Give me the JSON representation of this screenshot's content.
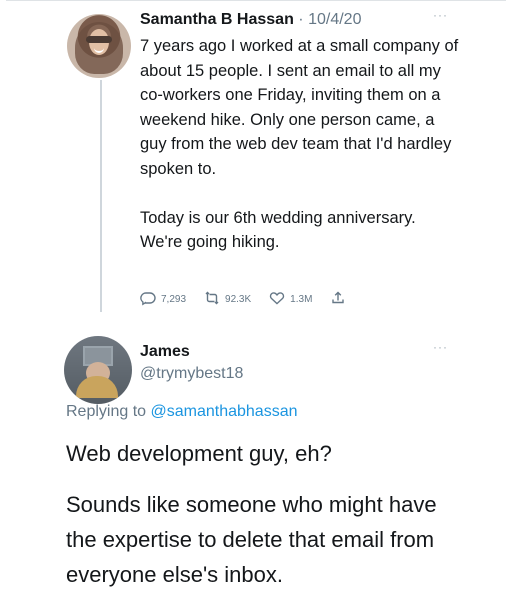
{
  "tweet": {
    "author": {
      "name": "Samantha B Hassan",
      "separator": "·",
      "date": "10/4/20"
    },
    "body": {
      "paragraph_1": "7 years ago I worked at a small company of about 15 people. I sent an email to all my co-workers one Friday, inviting them on a weekend hike. Only one person came, a guy from the web dev team that I'd hardley spoken to.",
      "paragraph_2": "Today is our 6th wedding anniversary. We're going hiking."
    },
    "actions": {
      "replies": "7,293",
      "retweets": "92.3K",
      "likes": "1.3M"
    },
    "more": "···",
    "icons": {
      "reply": "reply-icon",
      "retweet": "retweet-icon",
      "like": "heart-icon",
      "share": "share-icon"
    }
  },
  "reply": {
    "author": {
      "name": "James",
      "handle": "@trymybest18"
    },
    "replying_to": {
      "prefix": "Replying to ",
      "mention": "@samanthabhassan"
    },
    "body": {
      "line_1": "Web development guy, eh?",
      "line_2": "Sounds like someone who might have the expertise to delete that email from everyone else's inbox."
    },
    "more": "···"
  },
  "colors": {
    "text_primary": "#14171a",
    "text_secondary": "#657786",
    "mention": "#1b95e0",
    "thread_line": "#cfd6dc"
  }
}
